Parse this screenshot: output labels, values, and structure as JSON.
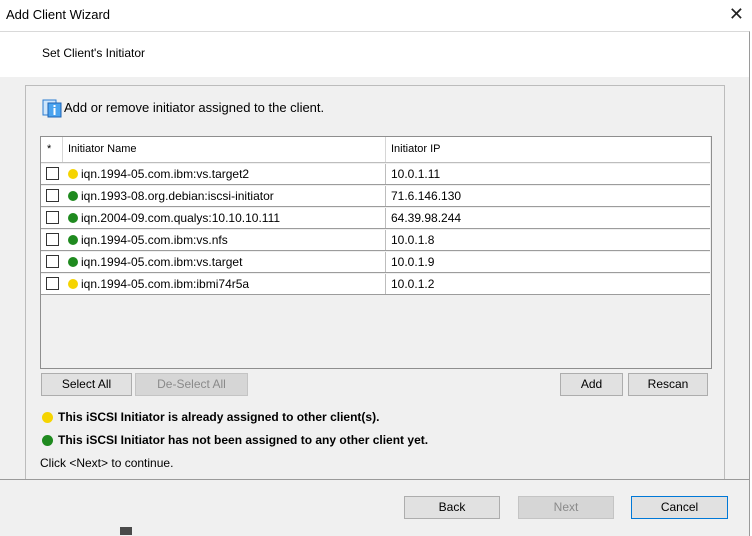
{
  "window": {
    "title": "Add Client Wizard",
    "close_glyph": "✕"
  },
  "step": {
    "title": "Set Client's Initiator"
  },
  "intro": {
    "text": "Add or remove initiator assigned to the client.",
    "icon": "info-icon"
  },
  "grid": {
    "columns": {
      "check": "*",
      "name": "Initiator Name",
      "ip": "Initiator IP"
    },
    "rows": [
      {
        "name": "iqn.1994-05.com.ibm:vs.target2",
        "ip": "10.0.1.11",
        "status": "assigned",
        "checked": false
      },
      {
        "name": "iqn.1993-08.org.debian:iscsi-initiator",
        "ip": "71.6.146.130",
        "status": "unassigned",
        "checked": false
      },
      {
        "name": "iqn.2004-09.com.qualys:10.10.10.111",
        "ip": "64.39.98.244",
        "status": "unassigned",
        "checked": false
      },
      {
        "name": "iqn.1994-05.com.ibm:vs.nfs",
        "ip": "10.0.1.8",
        "status": "unassigned",
        "checked": false
      },
      {
        "name": "iqn.1994-05.com.ibm:vs.target",
        "ip": "10.0.1.9",
        "status": "unassigned",
        "checked": false
      },
      {
        "name": "iqn.1994-05.com.ibm:ibmi74r5a",
        "ip": "10.0.1.2",
        "status": "assigned",
        "checked": false
      }
    ]
  },
  "grid_buttons": {
    "select_all": "Select All",
    "deselect_all": "De-Select All",
    "add": "Add",
    "rescan": "Rescan"
  },
  "legend": {
    "assigned": "This iSCSI Initiator is already assigned to other client(s).",
    "unassigned": "This iSCSI Initiator has not been assigned to any other client yet."
  },
  "continue_text": "Click <Next> to continue.",
  "footer": {
    "back": "Back",
    "next": "Next",
    "cancel": "Cancel"
  },
  "colors": {
    "assigned": "#f5d400",
    "unassigned": "#1f8a1f",
    "background": "#f0f0f0"
  }
}
